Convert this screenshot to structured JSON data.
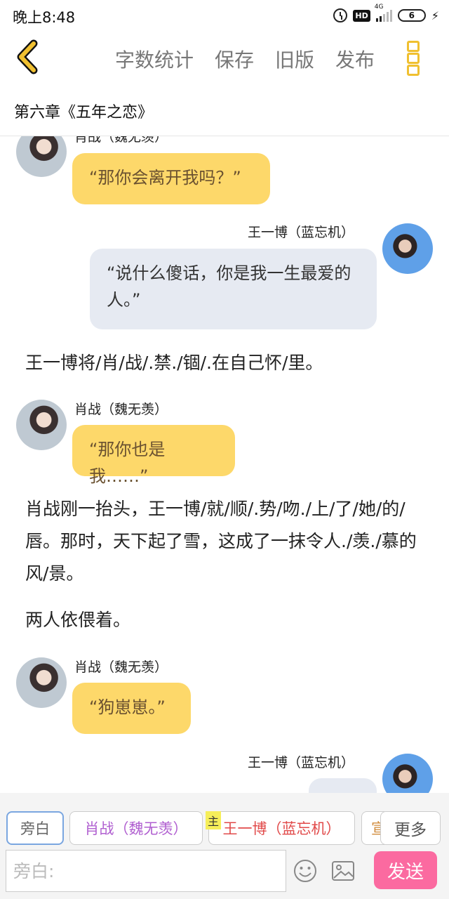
{
  "status_bar": {
    "time": "晚上8:48",
    "hd": "HD",
    "network": "4G",
    "battery": "6",
    "icons": [
      "alarm-icon",
      "hd-icon",
      "signal-icon",
      "battery-icon",
      "charging-icon"
    ]
  },
  "toolbar": {
    "back_icon": "chevron-left-icon",
    "word_count": "字数统计",
    "save": "保存",
    "old_version": "旧版",
    "publish": "发布",
    "more_icon": "more-vertical-icon"
  },
  "chapter_title": "第六章《五年之恋》",
  "messages": [
    {
      "type": "dialogue",
      "side": "left",
      "speaker": "肖战（魏无羡）",
      "text": "“那你会离开我吗？”"
    },
    {
      "type": "dialogue",
      "side": "right",
      "speaker": "王一博（蓝忘机）",
      "text": "“说什么傻话，你是我一生最爱的人。”"
    },
    {
      "type": "narration",
      "text": "王一博将/肖/战/.禁./锢/.在自己怀/里。"
    },
    {
      "type": "dialogue",
      "side": "left",
      "speaker": "肖战（魏无羡）",
      "text": "“那你也是我……”"
    },
    {
      "type": "narration",
      "text": "肖战刚一抬头，王一博/就/顺/.势/吻./上/了/她/的/唇。那时，天下起了雪，这成了一抹令人./羡./慕的风/景。"
    },
    {
      "type": "narration",
      "text": "两人依偎着。"
    },
    {
      "type": "dialogue",
      "side": "left",
      "speaker": "肖战（魏无羡）",
      "text": "“狗崽崽。”"
    },
    {
      "type": "dialogue",
      "side": "right",
      "speaker": "王一博（蓝忘机）",
      "text": ""
    }
  ],
  "roles": {
    "narrator": "旁白",
    "xiao": "肖战（魏无羡）",
    "wang": "王一博（蓝忘机）",
    "clipped": "宣",
    "main_tag": "主",
    "more": "更多"
  },
  "composer": {
    "placeholder": "旁白:",
    "emoji_icon": "emoji-icon",
    "image_icon": "image-icon",
    "send": "发送"
  },
  "colors": {
    "accent_yellow": "#fdd86a",
    "bubble_grey": "#e6eaf2",
    "send_pink": "#fb6aa0",
    "back_yellow": "#f0c030"
  }
}
